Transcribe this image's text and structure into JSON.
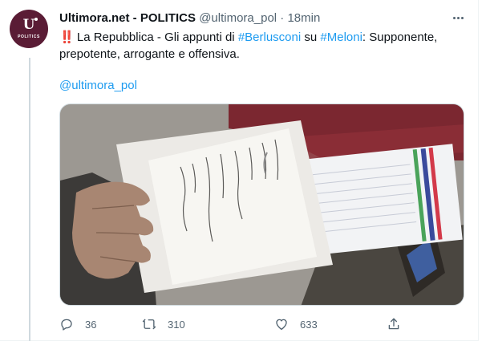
{
  "tweet": {
    "author_name": "Ultimora.net - POLITICS",
    "handle": "@ultimora_pol",
    "separator": "·",
    "time": "18min",
    "avatar_label": "POLITICS",
    "avatar_mark": "U",
    "text": {
      "emoji": "‼️",
      "source": " La Repubblica - Gli appunti di ",
      "hashtag1": "#Berlusconi",
      "mid": " su ",
      "hashtag2": "#Meloni",
      "rest": ": Supponente, prepotente, arrogante e offensiva."
    },
    "mention": "@ultimora_pol",
    "media_alt": "Photo of handwritten notes held in hand"
  },
  "actions": {
    "reply_count": "36",
    "retweet_count": "310",
    "like_count": "633"
  },
  "colors": {
    "link": "#1d9bf0",
    "secondary_text": "#536471",
    "avatar_bg": "#5a1c35"
  }
}
